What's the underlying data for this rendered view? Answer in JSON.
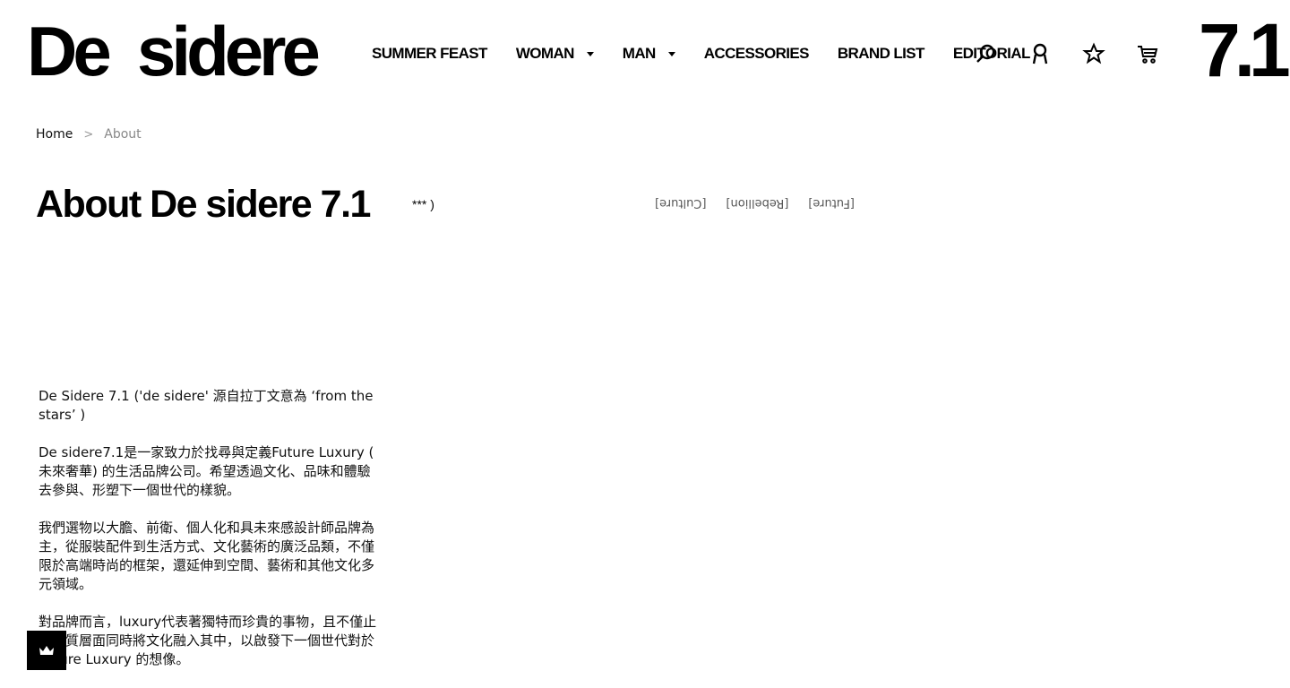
{
  "header": {
    "logo": "De  sidere",
    "brand_mark": "7.1",
    "nav": [
      {
        "label": "SUMMER FEAST",
        "dropdown": false
      },
      {
        "label": "WOMAN",
        "dropdown": true
      },
      {
        "label": "MAN",
        "dropdown": true
      },
      {
        "label": "ACCESSORIES",
        "dropdown": false
      },
      {
        "label": "BRAND LIST",
        "dropdown": false
      },
      {
        "label": "EDITORIAL",
        "dropdown": false
      }
    ],
    "icons": [
      "search-icon",
      "user-icon",
      "star-icon",
      "cart-icon"
    ]
  },
  "breadcrumb": {
    "home": "Home",
    "separator": ">",
    "current": "About"
  },
  "page": {
    "title": "About De sidere 7.1",
    "marquee_note": "*** )",
    "flipped_tags": [
      "[Future]",
      "[Rebellion]",
      "[Culture]"
    ]
  },
  "about": {
    "paragraphs": [
      "De Sidere 7.1 ('de sidere' 源自拉丁文意為 ‘from the stars’ )",
      "De sidere7.1是一家致力於找尋與定義Future Luxury ( 未來奢華) 的生活品牌公司。希望透過文化、品味和體驗去參與、形塑下一個世代的樣貌。",
      "我們選物以大膽、前衛、個人化和具未來感設計師品牌為主，從服裝配件到生活方式、文化藝術的廣泛品類，不僅限於高端時尚的框架，還延伸到空間、藝術和其他文化多元領域。",
      "對品牌而言，luxury代表著獨特而珍貴的事物，且不僅止於物質層面同時將文化融入其中，以啟發下一個世代對於Future Luxury 的想像。"
    ]
  },
  "floating_button": {
    "icon": "crown-icon"
  }
}
